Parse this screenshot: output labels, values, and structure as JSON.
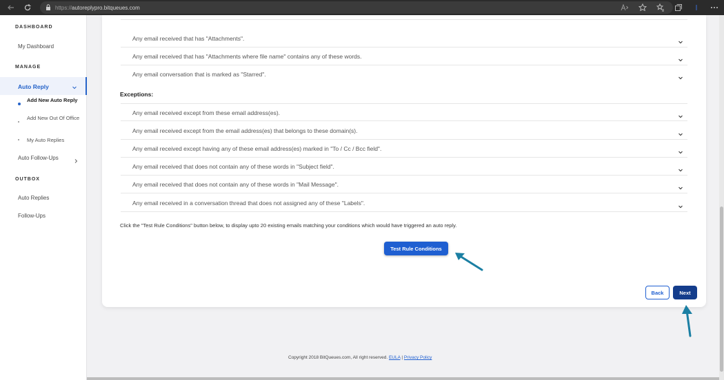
{
  "browser": {
    "url_proto": "https://",
    "url_host": "autoreplypro.bitqueues.com"
  },
  "sidebar": {
    "dashboard_heading": "DASHBOARD",
    "my_dashboard": "My Dashboard",
    "manage_heading": "MANAGE",
    "auto_reply": "Auto Reply",
    "sub_items": [
      "Add New Auto Reply",
      "Add New Out Of Office",
      "My Auto Replies"
    ],
    "auto_follow_ups": "Auto Follow-Ups",
    "outbox_heading": "OUTBOX",
    "outbox_items": [
      "Auto Replies",
      "Follow-Ups"
    ]
  },
  "conditions": [
    "Any email received that has \"Attachments\".",
    "Any email received that has \"Attachments where file name\" contains any of these words.",
    "Any email conversation that is marked as \"Starred\"."
  ],
  "exceptions_label": "Exceptions:",
  "exceptions": [
    "Any email received except from these email address(es).",
    "Any email received except from the email address(es) that belongs to these domain(s).",
    "Any email received except having any of these email address(es) marked in \"To / Cc / Bcc field\".",
    "Any email received that does not contain any of these words in \"Subject field\".",
    "Any email received that does not contain any of these words in \"Mail Message\".",
    "Any email received in a conversation thread that does not assigned any of these \"Labels\"."
  ],
  "hint": "Click the \"Test Rule Conditions\" button below, to display upto 20 existing emails matching your conditions which would have triggered an auto reply.",
  "buttons": {
    "test": "Test Rule Conditions",
    "back": "Back",
    "next": "Next"
  },
  "footer": {
    "copyright": "Copyright 2018 BitQueues.com, All right reserved.",
    "eula": "EULA",
    "sep": " | ",
    "privacy": "Privacy Policy"
  },
  "colors": {
    "accent": "#1f5fd1",
    "next": "#143d8c",
    "annotation_arrow": "#1b7fa3"
  }
}
